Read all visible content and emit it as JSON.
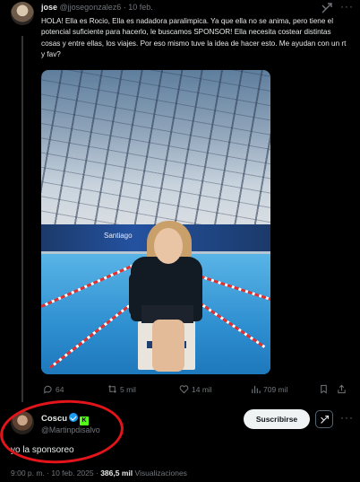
{
  "quoted_tweet": {
    "author_name": "jose",
    "handle": "@jjosegonzalez6",
    "date": "· 10 feb.",
    "text": "HOLA! Ella es Rocio, Ella es nadadora paralimpica. Ya que ella no se anima, pero tiene el potencial suficiente para hacerlo, le buscamos SPONSOR! Ella necesita costear distintas cosas y entre ellas, los viajes. Por eso mismo tuve la idea de hacer esto. Me ayudan con un rt y fav?",
    "image_banner_text": "Santiago",
    "actions": {
      "replies": "64",
      "reposts": "5 mil",
      "likes": "14 mil",
      "views": "709 mil"
    }
  },
  "reply_tweet": {
    "author_name": "Coscu",
    "kick_badge": "K",
    "handle": "@Martinpdisalvo",
    "subscribe_label": "Suscribirse",
    "text": "yo la sponsoreo",
    "time": "9:00 p. m. · 10 feb. 2025 ·",
    "views_count": "386,5 mil",
    "views_label": "Visualizaciones"
  },
  "icons": {
    "more": "more-horizontal-icon",
    "grok": "grok-icon",
    "reply": "reply-icon",
    "repost": "repost-icon",
    "like": "heart-icon",
    "views": "views-chart-icon",
    "bookmark": "bookmark-icon",
    "share": "share-icon",
    "verified": "verified-badge-icon"
  },
  "colors": {
    "background": "#000000",
    "accent": "#1d9bf0",
    "annotation_circle": "#e4141b",
    "kick_green": "#53fc18"
  }
}
